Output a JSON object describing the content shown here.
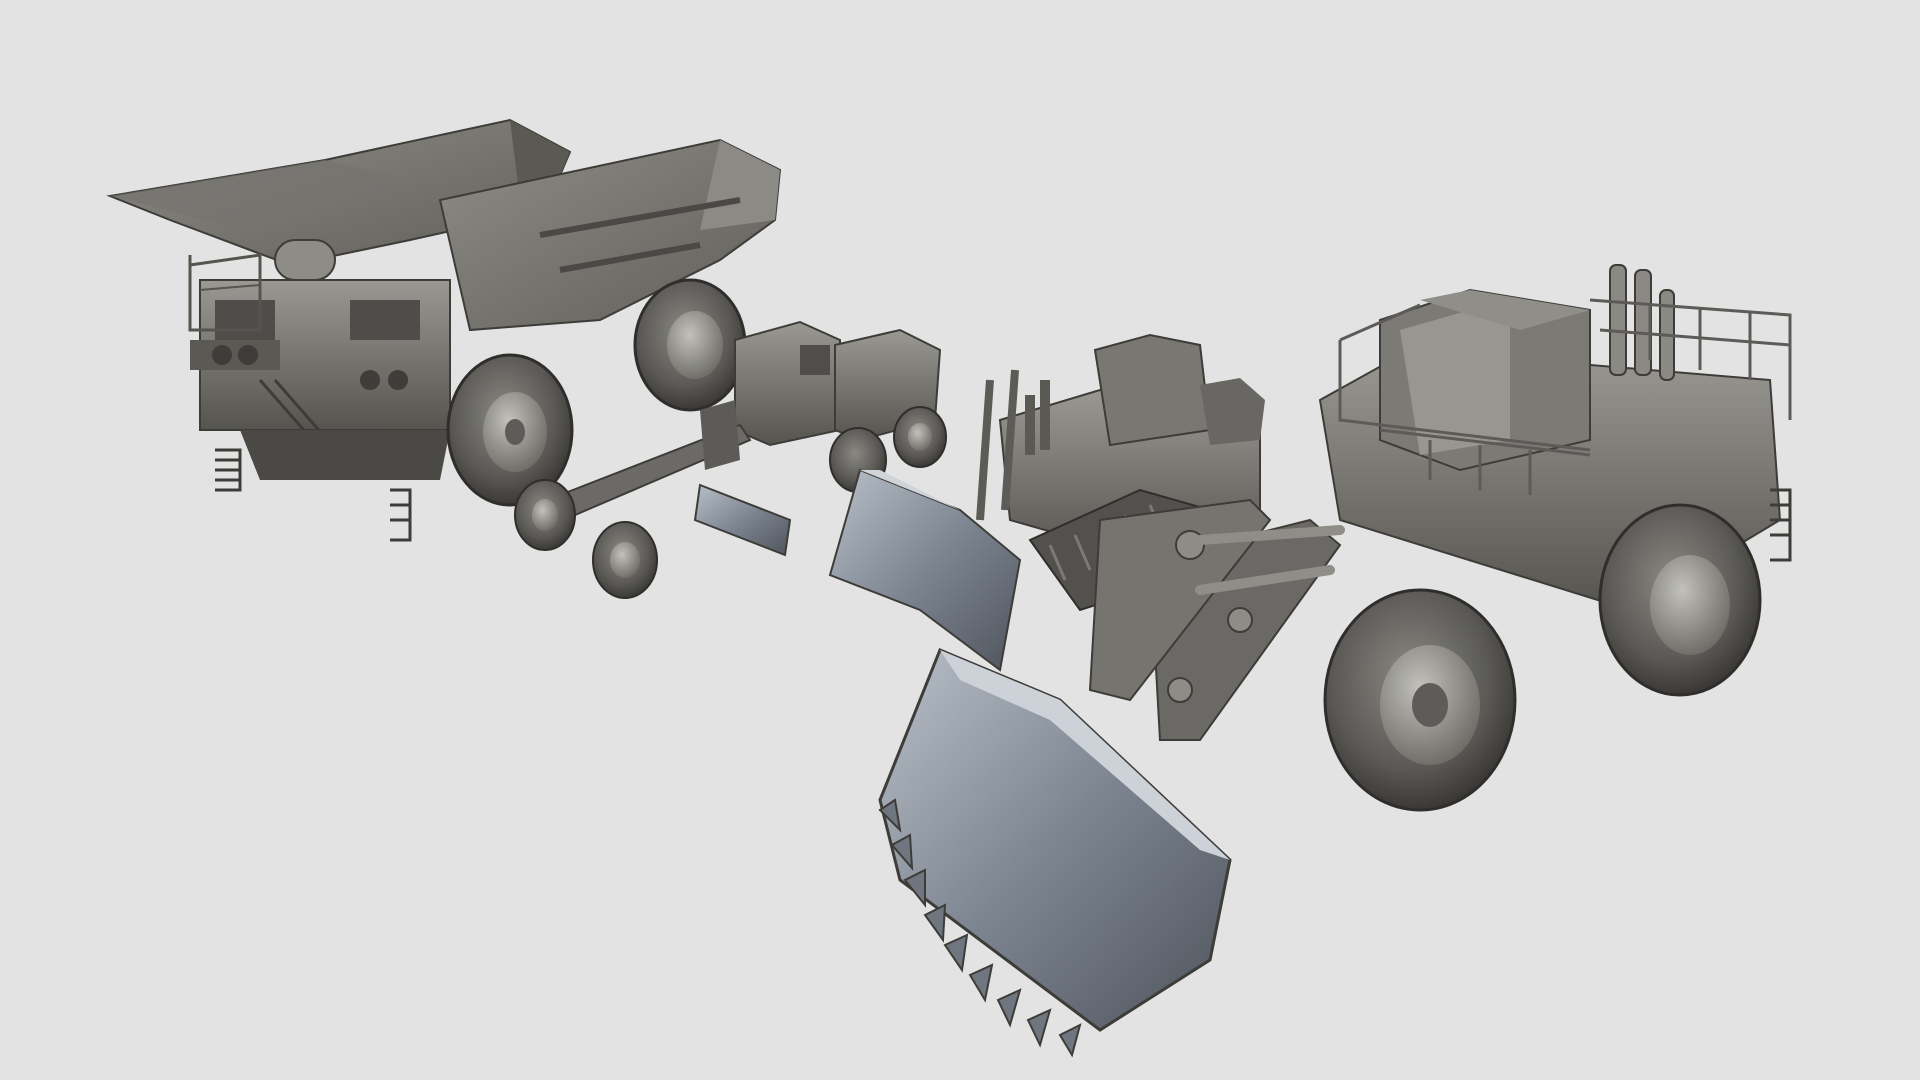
{
  "scene": {
    "background": "#e3e3e3",
    "model_color": "#6d6c68",
    "model_highlight": "#a09f9a",
    "model_shadow": "#3c3b38",
    "blade_tint": "#8d97a3",
    "objects": [
      {
        "id": "haul-truck",
        "kind": "mining dump truck"
      },
      {
        "id": "motor-grader",
        "kind": "motor grader"
      },
      {
        "id": "dozer",
        "kind": "crawler bulldozer"
      },
      {
        "id": "wheel-loader",
        "kind": "front wheel loader"
      }
    ]
  }
}
